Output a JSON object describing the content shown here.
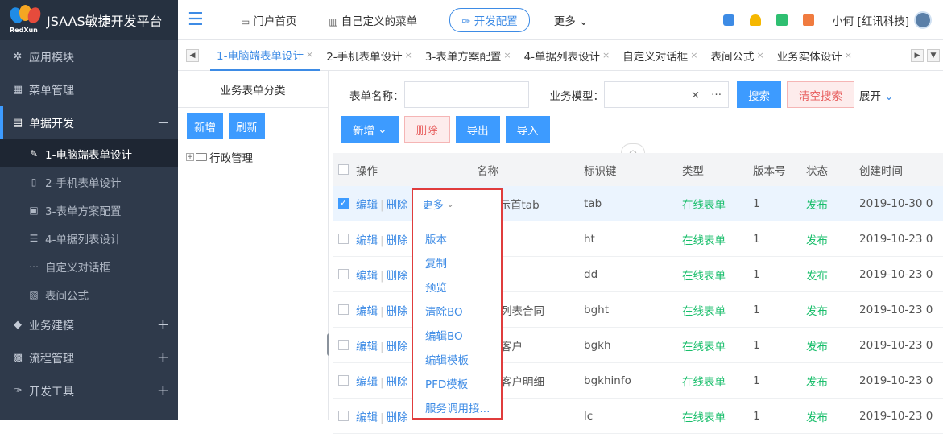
{
  "app": {
    "logo_brand": "RedXun",
    "title": "JSAAS敏捷开发平台"
  },
  "sidebar": {
    "items": [
      {
        "label": "应用模块",
        "icon": "gear-icon"
      },
      {
        "label": "菜单管理",
        "icon": "grid-icon"
      },
      {
        "label": "单据开发",
        "icon": "doc-icon",
        "open": true
      },
      {
        "label": "业务建模",
        "icon": "cube-icon"
      },
      {
        "label": "流程管理",
        "icon": "flow-icon"
      },
      {
        "label": "开发工具",
        "icon": "wrench-icon"
      }
    ],
    "sub_items": [
      {
        "label": "1-电脑端表单设计",
        "active": true
      },
      {
        "label": "2-手机表单设计"
      },
      {
        "label": "3-表单方案配置"
      },
      {
        "label": "4-单据列表设计"
      },
      {
        "label": "自定义对话框"
      },
      {
        "label": "表间公式"
      }
    ]
  },
  "topbar": {
    "nav": [
      "门户首页",
      "自己定义的菜单"
    ],
    "dev_config": "开发配置",
    "more": "更多",
    "user": "小何 [红讯科技]"
  },
  "tabs": [
    "1-电脑端表单设计",
    "2-手机表单设计",
    "3-表单方案配置",
    "4-单据列表设计",
    "自定义对话框",
    "表间公式",
    "业务实体设计"
  ],
  "category": {
    "title": "业务表单分类",
    "add": "新增",
    "refresh": "刷新",
    "tree_root": "行政管理"
  },
  "search": {
    "form_name_label": "表单名称：",
    "biz_model_label": "业务模型：",
    "search_btn": "搜索",
    "clear_btn": "清空搜索",
    "expand": "展开"
  },
  "toolbar": {
    "add": "新增",
    "delete": "删除",
    "export": "导出",
    "import": "导入"
  },
  "table": {
    "headers": [
      "操作",
      "名称",
      "标识键",
      "类型",
      "版本号",
      "状态",
      "创建时间"
    ],
    "edit": "编辑",
    "remove": "删除",
    "rows": [
      {
        "name": "展示首tab",
        "key": "tab",
        "type": "在线表单",
        "version": "1",
        "status": "发布",
        "created": "2019-10-30 0",
        "selected": true
      },
      {
        "name": "",
        "key": "ht",
        "type": "在线表单",
        "version": "1",
        "status": "发布",
        "created": "2019-10-23 0"
      },
      {
        "name": "",
        "key": "dd",
        "type": "在线表单",
        "version": "1",
        "status": "发布",
        "created": "2019-10-23 0"
      },
      {
        "name": "列表合同",
        "key": "bght",
        "type": "在线表单",
        "version": "1",
        "status": "发布",
        "created": "2019-10-23 0"
      },
      {
        "name": "客户",
        "key": "bgkh",
        "type": "在线表单",
        "version": "1",
        "status": "发布",
        "created": "2019-10-23 0"
      },
      {
        "name": "客户明细",
        "key": "bgkhinfo",
        "type": "在线表单",
        "version": "1",
        "status": "发布",
        "created": "2019-10-23 0"
      },
      {
        "name": "",
        "key": "lc",
        "type": "在线表单",
        "version": "1",
        "status": "发布",
        "created": "2019-10-23 0"
      }
    ]
  },
  "dropdown": {
    "trigger": "更多",
    "items": [
      "版本",
      "复制",
      "预览",
      "清除BO",
      "编辑BO",
      "编辑模板",
      "PFD模板",
      "服务调用接..."
    ]
  }
}
